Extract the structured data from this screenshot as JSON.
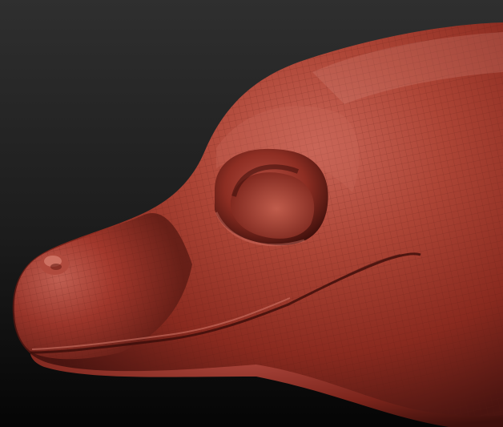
{
  "scene": {
    "subject": "sculpted-reptile-head",
    "background_top": "#2f2f2f",
    "background_bottom": "#050505",
    "clay_base": "#a63a2e",
    "clay_highlight": "#cf6a5c",
    "clay_shadow": "#4a1410",
    "wire_color": "#5a1a14"
  }
}
